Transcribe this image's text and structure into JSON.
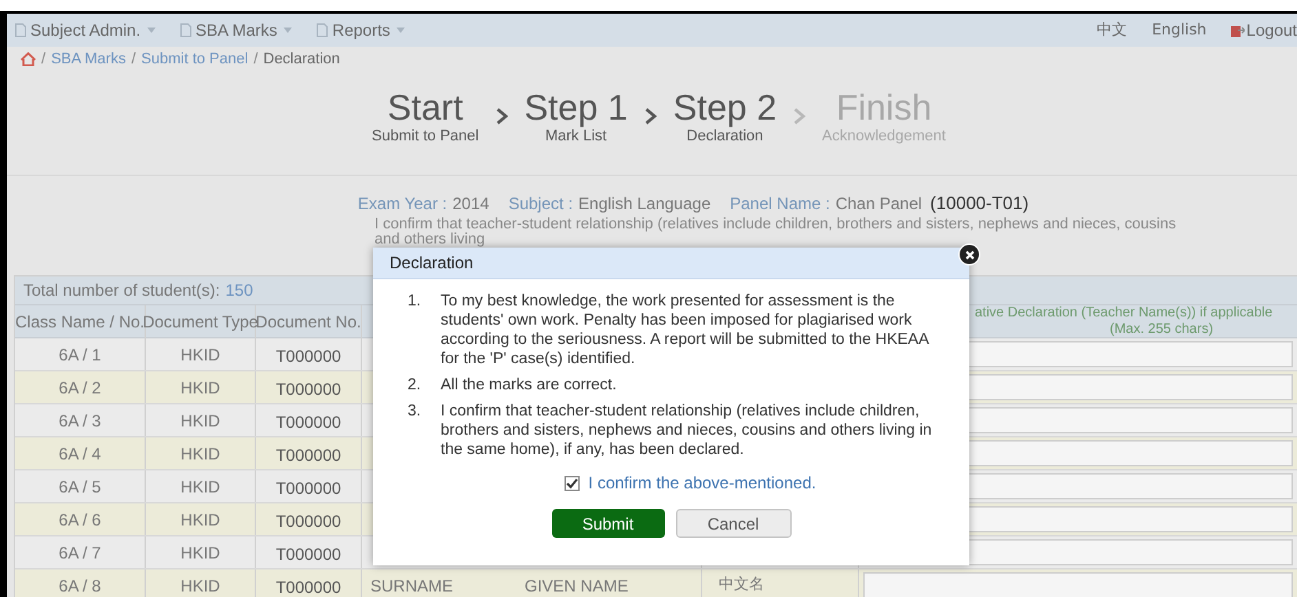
{
  "nav": {
    "menus": [
      {
        "label": "Subject Admin."
      },
      {
        "label": "SBA Marks"
      },
      {
        "label": "Reports"
      }
    ],
    "links": [
      {
        "label": "中文",
        "kind": "lang"
      },
      {
        "label": "English",
        "kind": "lang"
      },
      {
        "label": "Logout",
        "kind": "logout"
      }
    ]
  },
  "breadcrumb": {
    "separator": "/",
    "items": [
      {
        "label": "SBA Marks",
        "kind": "link"
      },
      {
        "label": "Submit to Panel",
        "kind": "link"
      },
      {
        "label": "Declaration",
        "kind": "current"
      }
    ]
  },
  "steps": [
    {
      "title": "Start",
      "subtitle": "Submit to Panel",
      "reached": true
    },
    {
      "title": "Step 1",
      "subtitle": "Mark List",
      "reached": true
    },
    {
      "title": "Step 2",
      "subtitle": "Declaration",
      "reached": true
    },
    {
      "title": "Finish",
      "subtitle": "Acknowledgement",
      "reached": false
    }
  ],
  "exam_info": [
    {
      "label": "Exam Year :",
      "value": "2014"
    },
    {
      "label": "Subject :",
      "value": "English Language"
    },
    {
      "label": "Panel Name :",
      "value": "Chan Panel",
      "code": "(10000-T01)"
    }
  ],
  "notice_lines": [
    "I confirm that teacher-student relationship (relatives include children, brothers and sisters, nephews and nieces, cousins",
    "and others living"
  ],
  "table": {
    "total_label": "Total number of student(s):",
    "total": "150",
    "columns": [
      "Class Name / No.",
      "Document Type",
      "Document No."
    ],
    "declaration_column": {
      "label": "ative Declaration (Teacher Name(s)) if applicable",
      "note": "(Max. 255 chars)"
    },
    "rows": [
      {
        "class": "6A / 1",
        "doc_type": "HKID",
        "doc_no": "T000000"
      },
      {
        "class": "6A / 2",
        "doc_type": "HKID",
        "doc_no": "T000000"
      },
      {
        "class": "6A / 3",
        "doc_type": "HKID",
        "doc_no": "T000000"
      },
      {
        "class": "6A / 4",
        "doc_type": "HKID",
        "doc_no": "T000000"
      },
      {
        "class": "6A / 5",
        "doc_type": "HKID",
        "doc_no": "T000000"
      },
      {
        "class": "6A / 6",
        "doc_type": "HKID",
        "doc_no": "T000000"
      },
      {
        "class": "6A / 7",
        "doc_type": "HKID",
        "doc_no": "T000000"
      },
      {
        "class": "6A / 8",
        "doc_type": "HKID",
        "doc_no": "T000000",
        "surname": "SURNAME",
        "given_name": "GIVEN NAME",
        "chinese_name": "中文名"
      }
    ]
  },
  "dialog": {
    "title": "Declaration",
    "items": [
      {
        "number": "1.",
        "text": "To my best knowledge, the work presented for assessment is the students' own work. Penalty has been imposed for plagiarised work according to the seriousness. A report will be submitted to the HKEAA for the 'P' case(s) identified."
      },
      {
        "number": "2.",
        "text": "All the marks are correct."
      },
      {
        "number": "3.",
        "text": "I confirm that teacher-student relationship (relatives include children, brothers and sisters, nephews and nieces, cousins and others living in the same home), if any, has been declared."
      }
    ],
    "confirm": {
      "label": "I confirm the above-mentioned.",
      "checked": true
    },
    "buttons": [
      {
        "label": "Submit",
        "kind": "primary"
      },
      {
        "label": "Cancel",
        "kind": "secondary"
      }
    ]
  }
}
